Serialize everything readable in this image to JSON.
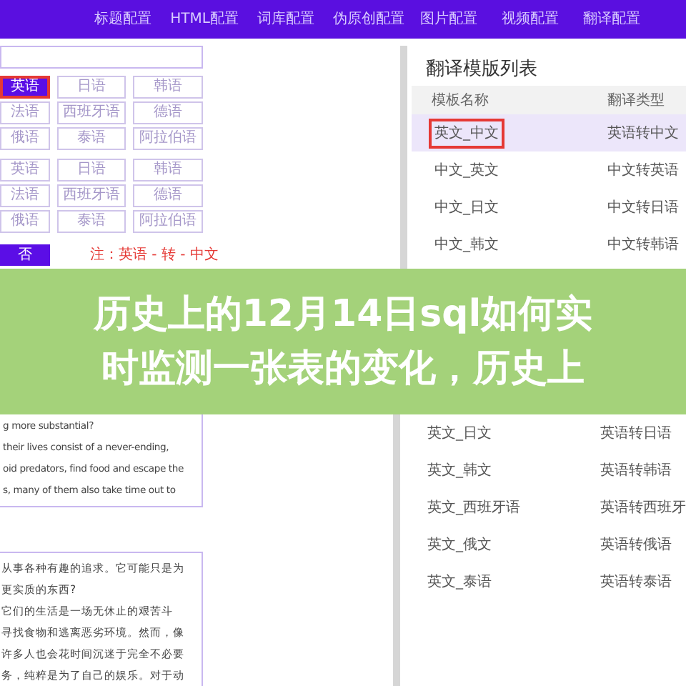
{
  "nav": {
    "items": [
      "标题配置",
      "HTML配置",
      "词库配置",
      "伪原创配置",
      "图片配置",
      "视频配置",
      "翻译配置"
    ]
  },
  "left": {
    "source_grids": [
      [
        {
          "label": "英语",
          "selected": true
        },
        {
          "label": "日语",
          "selected": false
        },
        {
          "label": "韩语",
          "selected": false
        },
        {
          "label": "法语",
          "selected": false
        },
        {
          "label": "西班牙语",
          "selected": false
        },
        {
          "label": "德语",
          "selected": false
        },
        {
          "label": "俄语",
          "selected": false
        },
        {
          "label": "泰语",
          "selected": false
        },
        {
          "label": "阿拉伯语",
          "selected": false
        }
      ],
      [
        {
          "label": "英语",
          "selected": false
        },
        {
          "label": "日语",
          "selected": false
        },
        {
          "label": "韩语",
          "selected": false
        },
        {
          "label": "法语",
          "selected": false
        },
        {
          "label": "西班牙语",
          "selected": false
        },
        {
          "label": "德语",
          "selected": false
        },
        {
          "label": "俄语",
          "selected": false
        },
        {
          "label": "泰语",
          "selected": false
        },
        {
          "label": "阿拉伯语",
          "selected": false
        }
      ]
    ],
    "toggle_button": "否",
    "note": "注：英语 - 转 - 中文",
    "english_text": [
      "g more substantial?",
      "their lives consist of a never-ending,",
      "oid predators, find food and escape the",
      "s, many of them also take time out to"
    ],
    "chinese_text": [
      "从事各种有趣的追求。它可能只是为",
      "更实质的东西?",
      "它们的生活是一场无休止的艰苦斗",
      "寻找食物和逃离恶劣环境。然而，像",
      "许多人也会花时间沉迷于完全不必要",
      "务，纯粹是为了自己的娱乐。对于动"
    ]
  },
  "banner": {
    "lines": [
      "历史上的12月14日sql如何实",
      "时监测一张表的变化，历史上"
    ]
  },
  "template_list": {
    "title": "翻译模版列表",
    "columns": [
      "模板名称",
      "翻译类型"
    ],
    "rows_top": [
      {
        "name": "英文_中文",
        "type": "英语转中文",
        "selected": true
      },
      {
        "name": "中文_英文",
        "type": "中文转英语",
        "selected": false
      },
      {
        "name": "中文_日文",
        "type": "中文转日语",
        "selected": false
      },
      {
        "name": "中文_韩文",
        "type": "中文转韩语",
        "selected": false
      }
    ],
    "rows_bottom": [
      {
        "name": "英文_日文",
        "type": "英语转日语",
        "selected": false
      },
      {
        "name": "英文_韩文",
        "type": "英语转韩语",
        "selected": false
      },
      {
        "name": "英文_西班牙语",
        "type": "英语转西班牙",
        "selected": false
      },
      {
        "name": "英文_俄文",
        "type": "英语转俄语",
        "selected": false
      },
      {
        "name": "英文_泰语",
        "type": "英语转泰语",
        "selected": false
      }
    ]
  }
}
